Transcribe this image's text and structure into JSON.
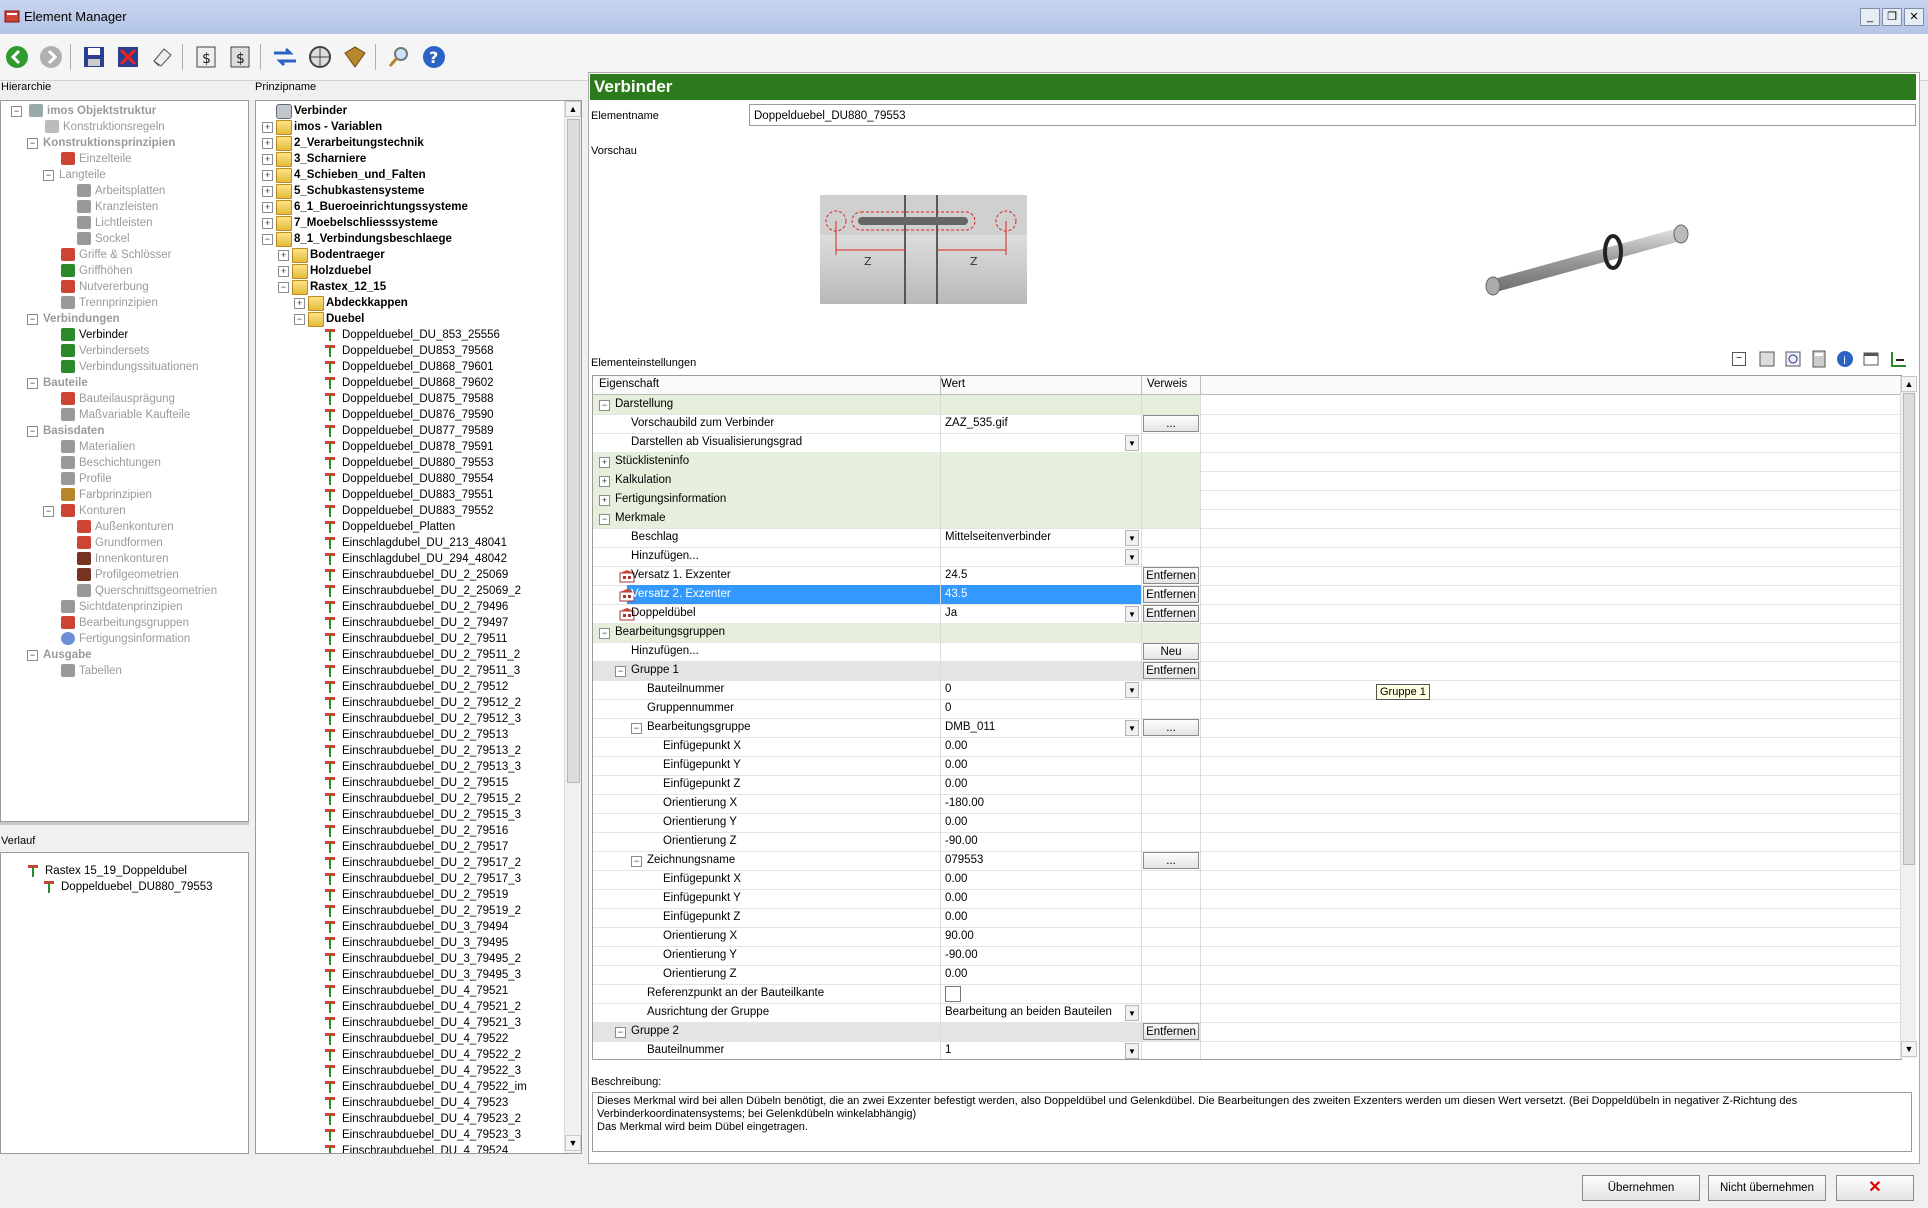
{
  "window": {
    "title": "Element Manager"
  },
  "panes": {
    "hierarchie_label": "Hierarchie",
    "prinzipname_label": "Prinzipname",
    "verlauf_label": "Verlauf"
  },
  "hierarchy": [
    {
      "label": "imos Objektstruktur",
      "bold": true
    },
    {
      "label": "Konstruktionsregeln"
    },
    {
      "label": "Konstruktionsprinzipien",
      "bold": true
    },
    {
      "label": "Einzelteile"
    },
    {
      "label": "Langteile"
    },
    {
      "label": "Arbeitsplatten"
    },
    {
      "label": "Kranzleisten"
    },
    {
      "label": "Lichtleisten"
    },
    {
      "label": "Sockel"
    },
    {
      "label": "Griffe & Schlösser"
    },
    {
      "label": "Griffhöhen"
    },
    {
      "label": "Nutvererbung"
    },
    {
      "label": "Trennprinzipien"
    },
    {
      "label": "Verbindungen",
      "bold": true
    },
    {
      "label": "Verbinder",
      "active": true
    },
    {
      "label": "Verbindersets"
    },
    {
      "label": "Verbindungssituationen"
    },
    {
      "label": "Bauteile",
      "bold": true
    },
    {
      "label": "Bauteilausprägung"
    },
    {
      "label": "Maßvariable Kaufteile"
    },
    {
      "label": "Basisdaten",
      "bold": true
    },
    {
      "label": "Materialien"
    },
    {
      "label": "Beschichtungen"
    },
    {
      "label": "Profile"
    },
    {
      "label": "Farbprinzipien"
    },
    {
      "label": "Konturen"
    },
    {
      "label": "Außenkonturen"
    },
    {
      "label": "Grundformen"
    },
    {
      "label": "Innenkonturen"
    },
    {
      "label": "Profilgeometrien"
    },
    {
      "label": "Querschnittsgeometrien"
    },
    {
      "label": "Sichtdatenprinzipien"
    },
    {
      "label": "Bearbeitungsgruppen"
    },
    {
      "label": "Fertigungsinformation"
    },
    {
      "label": "Ausgabe",
      "bold": true
    },
    {
      "label": "Tabellen"
    }
  ],
  "verlauf": [
    {
      "label": "Rastex 15_19_Doppeldubel"
    },
    {
      "label": "Doppelduebel_DU880_79553"
    }
  ],
  "prinzip": {
    "root": "Verbinder",
    "folders": [
      {
        "label": "imos - Variablen"
      },
      {
        "label": "2_Verarbeitungstechnik"
      },
      {
        "label": "3_Scharniere"
      },
      {
        "label": "4_Schieben_und_Falten"
      },
      {
        "label": "5_Schubkastensysteme"
      },
      {
        "label": "6_1_Bueroeinrichtungssysteme"
      },
      {
        "label": "7_Moebelschliesssysteme"
      },
      {
        "label": "8_1_Verbindungsbeschlaege"
      },
      {
        "label": "Bodentraeger"
      },
      {
        "label": "Holzduebel"
      },
      {
        "label": "Rastex_12_15"
      },
      {
        "label": "Abdeckkappen"
      },
      {
        "label": "Duebel"
      }
    ],
    "items": [
      "Doppelduebel_DU_853_25556",
      "Doppelduebel_DU853_79568",
      "Doppelduebel_DU868_79601",
      "Doppelduebel_DU868_79602",
      "Doppelduebel_DU875_79588",
      "Doppelduebel_DU876_79590",
      "Doppelduebel_DU877_79589",
      "Doppelduebel_DU878_79591",
      "Doppelduebel_DU880_79553",
      "Doppelduebel_DU880_79554",
      "Doppelduebel_DU883_79551",
      "Doppelduebel_DU883_79552",
      "Doppelduebel_Platten",
      "Einschlagdubel_DU_213_48041",
      "Einschlagdubel_DU_294_48042",
      "Einschraubduebel_DU_2_25069",
      "Einschraubduebel_DU_2_25069_2",
      "Einschraubduebel_DU_2_79496",
      "Einschraubduebel_DU_2_79497",
      "Einschraubduebel_DU_2_79511",
      "Einschraubduebel_DU_2_79511_2",
      "Einschraubduebel_DU_2_79511_3",
      "Einschraubduebel_DU_2_79512",
      "Einschraubduebel_DU_2_79512_2",
      "Einschraubduebel_DU_2_79512_3",
      "Einschraubduebel_DU_2_79513",
      "Einschraubduebel_DU_2_79513_2",
      "Einschraubduebel_DU_2_79513_3",
      "Einschraubduebel_DU_2_79515",
      "Einschraubduebel_DU_2_79515_2",
      "Einschraubduebel_DU_2_79515_3",
      "Einschraubduebel_DU_2_79516",
      "Einschraubduebel_DU_2_79517",
      "Einschraubduebel_DU_2_79517_2",
      "Einschraubduebel_DU_2_79517_3",
      "Einschraubduebel_DU_2_79519",
      "Einschraubduebel_DU_2_79519_2",
      "Einschraubduebel_DU_3_79494",
      "Einschraubduebel_DU_3_79495",
      "Einschraubduebel_DU_3_79495_2",
      "Einschraubduebel_DU_3_79495_3",
      "Einschraubduebel_DU_4_79521",
      "Einschraubduebel_DU_4_79521_2",
      "Einschraubduebel_DU_4_79521_3",
      "Einschraubduebel_DU_4_79522",
      "Einschraubduebel_DU_4_79522_2",
      "Einschraubduebel_DU_4_79522_3",
      "Einschraubduebel_DU_4_79522_im",
      "Einschraubduebel_DU_4_79523",
      "Einschraubduebel_DU_4_79523_2",
      "Einschraubduebel_DU_4_79523_3",
      "Einschraubduebel_DU_4_79524"
    ]
  },
  "detail": {
    "header": "Verbinder",
    "elementname_label": "Elementname",
    "elementname_value": "Doppelduebel_DU880_79553",
    "vorschau_label": "Vorschau",
    "preview_z1": "Z",
    "preview_z2": "Z",
    "elementeinstellungen_label": "Elementeinstellungen",
    "col_eigenschaft": "Eigenschaft",
    "col_wert": "Wert",
    "col_verweis": "Verweis",
    "tooltip": "Gruppe 1",
    "beschreibung_label": "Beschreibung:",
    "beschreibung_line1": "Dieses Merkmal wird bei allen Dübeln benötigt, die an zwei Exzenter befestigt werden, also Doppeldübel und Gelenkdübel. Die Bearbeitungen des zweiten Exzenters werden um diesen Wert versetzt. (Bei Doppeldübeln in negativer Z-Richtung des",
    "beschreibung_line2": "Verbinderkoordinatensystems; bei Gelenkdübeln winkelabhängig)",
    "beschreibung_line3": "Das Merkmal wird beim Dübel eingetragen."
  },
  "grid": [
    {
      "indent": 0,
      "exp": "−",
      "type": "cat",
      "prop": "Darstellung",
      "value": "",
      "ref": ""
    },
    {
      "indent": 1,
      "exp": "",
      "type": "row",
      "prop": "Vorschaubild zum Verbinder",
      "value": "ZAZ_535.gif",
      "ref": "...",
      "refbtn": true
    },
    {
      "indent": 1,
      "exp": "",
      "type": "row",
      "prop": "Darstellen ab Visualisierungsgrad",
      "value": "",
      "ref": "",
      "dd": true
    },
    {
      "indent": 0,
      "exp": "+",
      "type": "cat",
      "prop": "Stücklisteninfo",
      "value": "",
      "ref": ""
    },
    {
      "indent": 0,
      "exp": "+",
      "type": "cat",
      "prop": "Kalkulation",
      "value": "",
      "ref": ""
    },
    {
      "indent": 0,
      "exp": "+",
      "type": "cat",
      "prop": "Fertigungsinformation",
      "value": "",
      "ref": ""
    },
    {
      "indent": 0,
      "exp": "−",
      "type": "cat",
      "prop": "Merkmale",
      "value": "",
      "ref": ""
    },
    {
      "indent": 1,
      "exp": "",
      "type": "row",
      "prop": "Beschlag",
      "value": "Mittelseitenverbinder",
      "ref": "",
      "dd": true
    },
    {
      "indent": 1,
      "exp": "",
      "type": "row",
      "prop": "Hinzufügen...",
      "value": "",
      "ref": "",
      "dd": true
    },
    {
      "indent": 1,
      "exp": "",
      "type": "row",
      "prop": "Versatz 1. Exzenter",
      "value": "24.5",
      "ref": "Entfernen",
      "refbtn": true,
      "icon": true
    },
    {
      "indent": 1,
      "exp": "",
      "type": "sel",
      "prop": "Versatz 2. Exzenter",
      "value": "43.5",
      "ref": "Entfernen",
      "refbtn": true,
      "icon": true
    },
    {
      "indent": 1,
      "exp": "",
      "type": "row",
      "prop": "Doppeldübel",
      "value": "Ja",
      "ref": "Entfernen",
      "refbtn": true,
      "icon": true,
      "dd": true
    },
    {
      "indent": 0,
      "exp": "−",
      "type": "cat",
      "prop": "Bearbeitungsgruppen",
      "value": "",
      "ref": ""
    },
    {
      "indent": 1,
      "exp": "",
      "type": "row",
      "prop": "Hinzufügen...",
      "value": "",
      "ref": "Neu",
      "refbtn": true
    },
    {
      "indent": 1,
      "exp": "−",
      "type": "grp",
      "prop": "Gruppe 1",
      "value": "",
      "ref": "Entfernen",
      "refbtn": true
    },
    {
      "indent": 2,
      "exp": "",
      "type": "row",
      "prop": "Bauteilnummer",
      "value": "0",
      "ref": "",
      "dd": true
    },
    {
      "indent": 2,
      "exp": "",
      "type": "row",
      "prop": "Gruppennummer",
      "value": "0",
      "ref": ""
    },
    {
      "indent": 2,
      "exp": "−",
      "type": "row",
      "prop": "Bearbeitungsgruppe",
      "value": "DMB_011",
      "ref": "...",
      "refbtn": true,
      "dd": true
    },
    {
      "indent": 3,
      "exp": "",
      "type": "row",
      "prop": "Einfügepunkt X",
      "value": "0.00",
      "ref": ""
    },
    {
      "indent": 3,
      "exp": "",
      "type": "row",
      "prop": "Einfügepunkt Y",
      "value": "0.00",
      "ref": ""
    },
    {
      "indent": 3,
      "exp": "",
      "type": "row",
      "prop": "Einfügepunkt Z",
      "value": "0.00",
      "ref": ""
    },
    {
      "indent": 3,
      "exp": "",
      "type": "row",
      "prop": "Orientierung X",
      "value": "-180.00",
      "ref": ""
    },
    {
      "indent": 3,
      "exp": "",
      "type": "row",
      "prop": "Orientierung Y",
      "value": "0.00",
      "ref": ""
    },
    {
      "indent": 3,
      "exp": "",
      "type": "row",
      "prop": "Orientierung Z",
      "value": "-90.00",
      "ref": ""
    },
    {
      "indent": 2,
      "exp": "−",
      "type": "row",
      "prop": "Zeichnungsname",
      "value": "079553",
      "ref": "...",
      "refbtn": true
    },
    {
      "indent": 3,
      "exp": "",
      "type": "row",
      "prop": "Einfügepunkt X",
      "value": "0.00",
      "ref": ""
    },
    {
      "indent": 3,
      "exp": "",
      "type": "row",
      "prop": "Einfügepunkt Y",
      "value": "0.00",
      "ref": ""
    },
    {
      "indent": 3,
      "exp": "",
      "type": "row",
      "prop": "Einfügepunkt Z",
      "value": "0.00",
      "ref": ""
    },
    {
      "indent": 3,
      "exp": "",
      "type": "row",
      "prop": "Orientierung X",
      "value": "90.00",
      "ref": ""
    },
    {
      "indent": 3,
      "exp": "",
      "type": "row",
      "prop": "Orientierung Y",
      "value": "-90.00",
      "ref": ""
    },
    {
      "indent": 3,
      "exp": "",
      "type": "row",
      "prop": "Orientierung Z",
      "value": "0.00",
      "ref": ""
    },
    {
      "indent": 2,
      "exp": "",
      "type": "row",
      "prop": "Referenzpunkt an der Bauteilkante",
      "value": "",
      "ref": "",
      "check": true
    },
    {
      "indent": 2,
      "exp": "",
      "type": "row",
      "prop": "Ausrichtung der Gruppe",
      "value": "Bearbeitung an beiden Bauteilen",
      "ref": "",
      "dd": true
    },
    {
      "indent": 1,
      "exp": "−",
      "type": "grp",
      "prop": "Gruppe 2",
      "value": "",
      "ref": "Entfernen",
      "refbtn": true
    },
    {
      "indent": 2,
      "exp": "",
      "type": "row",
      "prop": "Bauteilnummer",
      "value": "1",
      "ref": "",
      "dd": true
    }
  ],
  "footer": {
    "ok_label": "Übernehmen",
    "cancel_label": "Nicht übernehmen",
    "close_label": "✕"
  },
  "colors": {
    "header_green": "#2d7a1d",
    "category_bg": "#e6efdc",
    "selection_blue": "#3399ff"
  }
}
